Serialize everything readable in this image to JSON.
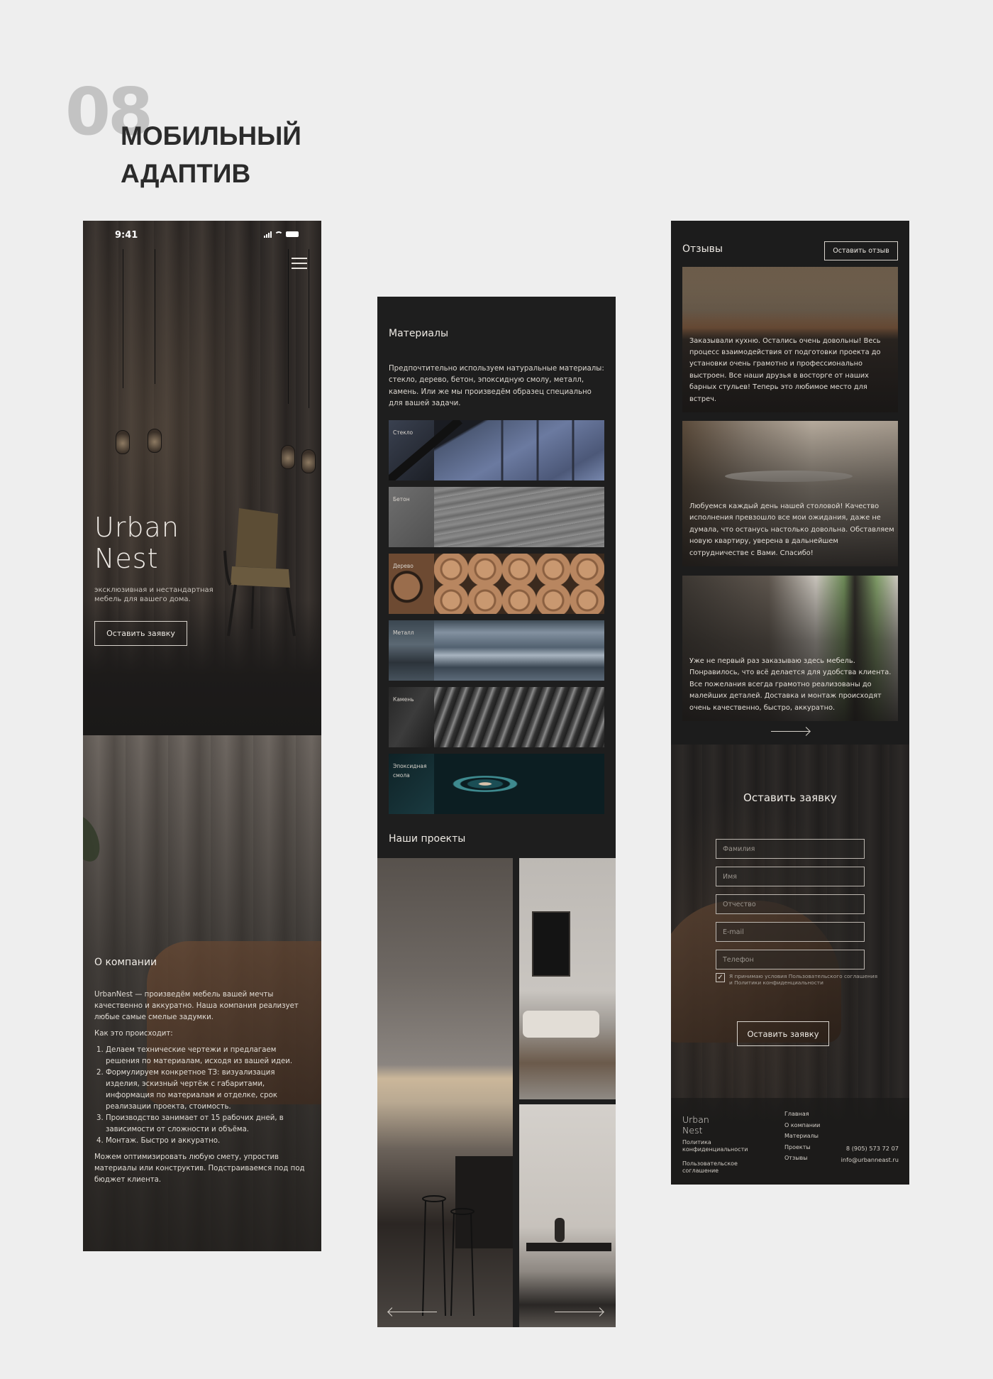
{
  "slide": {
    "number": "08",
    "title_line1": "МОБИЛЬНЫЙ",
    "title_line2": "АДАПТИВ"
  },
  "phone1": {
    "status_time": "9:41",
    "brand_line1": "Urban",
    "brand_line2": "Nest",
    "hero_subtitle": "эксклюзивная и нестандартная мебель для вашего дома.",
    "hero_button": "Оставить заявку",
    "about": {
      "title": "О компании",
      "intro": "UrbanNest — произведём мебель вашей мечты качественно и аккуратно. Наша компания реализует любые самые смелые задумки.",
      "how_label": "Как это происходит:",
      "steps": [
        "Делаем технические чертежи и предлагаем решения по материалам, исходя из вашей идеи.",
        "Формулируем конкретное ТЗ: визуализация изделия, эскизный чертёж с габаритами, информация по материалам и отделке, срок реализации проекта, стоимость.",
        "Производство занимает от 15 рабочих дней, в зависимости от сложности и объёма.",
        "Монтаж. Быстро и аккуратно."
      ],
      "outro": "Можем оптимизировать любую смету, упростив материалы или конструктив. Подстраиваемся под под бюджет клиента."
    }
  },
  "phone2": {
    "materials_title": "Материалы",
    "materials_description": "Предпочтительно используем натуральные материалы: стекло, дерево, бетон, эпоксидную смолу, металл, камень. Или же мы произведём образец специально для вашей задачи.",
    "materials": [
      {
        "label": "Стекло"
      },
      {
        "label": "Бетон"
      },
      {
        "label": "Дерево"
      },
      {
        "label": "Металл"
      },
      {
        "label": "Камень"
      },
      {
        "label": "Эпоксидная смола"
      }
    ],
    "projects_title": "Наши проекты"
  },
  "phone3": {
    "reviews_title": "Отзывы",
    "review_button": "Оставить отзыв",
    "reviews": [
      "Заказывали кухню. Остались очень довольны! Весь процесс взаимодействия от подготовки проекта до установки очень грамотно и профессионально выстроен. Все наши друзья в восторге от наших барных стульев! Теперь это любимое место для встреч.",
      "Любуемся каждый день нашей столовой! Качество исполнения превзошло все мои ожидания, даже не думала, что останусь настолько довольна. Обставляем новую квартиру, уверена в дальнейшем сотрудничестве с Вами. Спасибо!",
      "Уже не первый раз заказываю здесь мебель. Понравилось, что всё делается для удобства клиента. Все пожелания всегда грамотно реализованы до малейших деталей. Доставка и монтаж происходят очень качественно, быстро, аккуратно."
    ],
    "form": {
      "title": "Оставить заявку",
      "placeholders": {
        "last_name": "Фамилия",
        "first_name": "Имя",
        "patronymic": "Отчество",
        "email": "E-mail",
        "phone": "Телефон"
      },
      "consent_checked": true,
      "consent_text": "Я принимаю условия Пользовательского соглашения и Политики конфиденциальности",
      "submit": "Оставить заявку"
    },
    "footer": {
      "brand_line1": "Urban",
      "brand_line2": "Nest",
      "privacy": "Политика конфиденциальности",
      "agreement": "Пользовательское соглашение",
      "nav": [
        "Главная",
        "О компании",
        "Материалы",
        "Проекты",
        "Отзывы"
      ],
      "phone": "8 (905) 573 72 07",
      "email": "info@urbanneast.ru"
    }
  },
  "colors": {
    "page_background": "#eeeeee",
    "phone_background": "#1c1c1c",
    "text_light": "#e6e2dc",
    "slide_number": "#c3c3c3",
    "slide_title": "#2b2b2b"
  }
}
